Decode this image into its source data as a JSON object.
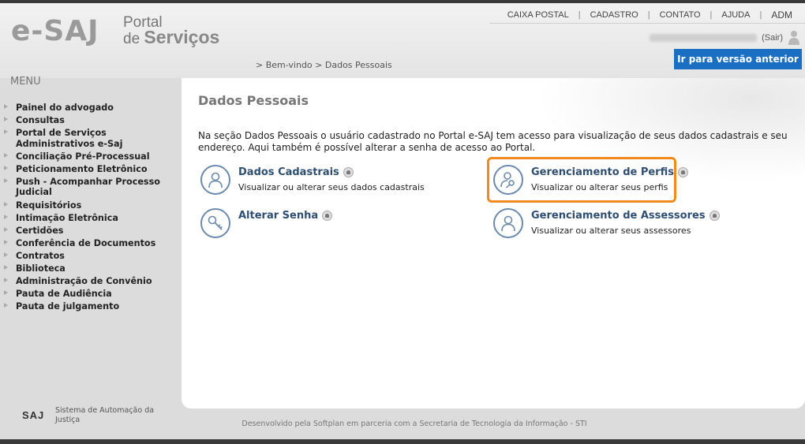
{
  "header": {
    "logo_main": "e-SAJ",
    "logo_portal": "Portal",
    "logo_de": "de",
    "logo_servicos": "Serviços"
  },
  "topnav": {
    "items": [
      "CAIXA POSTAL",
      "CADASTRO",
      "CONTATO",
      "AJUDA"
    ],
    "separator": "|",
    "adm": "ADM"
  },
  "user": {
    "logout": "(Sair)"
  },
  "breadcrumb": "> Bem-vindo > Dados Pessoais",
  "prev_version_button": "Ir para versão anterior",
  "menu": {
    "title": "MENU",
    "items": [
      "Painel do advogado",
      "Consultas",
      "Portal de Serviços Administrativos e-Saj",
      "Conciliação Pré-Processual",
      "Peticionamento Eletrônico",
      "Push - Acompanhar Processo Judicial",
      "Requisitórios",
      "Intimação Eletrônica",
      "Certidões",
      "Conferência de Documentos",
      "Contratos",
      "Biblioteca",
      "Administração de Convênio",
      "Pauta de Audiência",
      "Pauta de julgamento"
    ]
  },
  "content": {
    "title": "Dados Pessoais",
    "intro": "Na seção Dados Pessoais o usuário cadastrado no Portal e-SAJ tem acesso para visualização de seus dados cadastrais e seu endereço. Aqui também é possível alterar a senha de acesso ao Portal.",
    "cards": [
      {
        "title": "Dados Cadastrais",
        "desc": "Visualizar ou alterar seus dados cadastrais",
        "icon": "user-icon"
      },
      {
        "title": "Gerenciamento de Perfis",
        "desc": "Visualizar ou alterar seus perfis",
        "icon": "user-key-icon"
      },
      {
        "title": "Alterar Senha",
        "desc": "",
        "icon": "key-icon"
      },
      {
        "title": "Gerenciamento de Assessores",
        "desc": "Visualizar ou alterar seus assessores",
        "icon": "user-icon"
      }
    ]
  },
  "footer": {
    "logo": "SAJ",
    "system": "Sistema de Automação da Justiça",
    "developer": "Desenvolvido pela Softplan em parceria com a Secretaria de Tecnologia da Informação - STI"
  },
  "colors": {
    "accent_blue": "#1b6fc3",
    "highlight_orange": "#f08a1e",
    "card_title": "#2f4f72"
  }
}
